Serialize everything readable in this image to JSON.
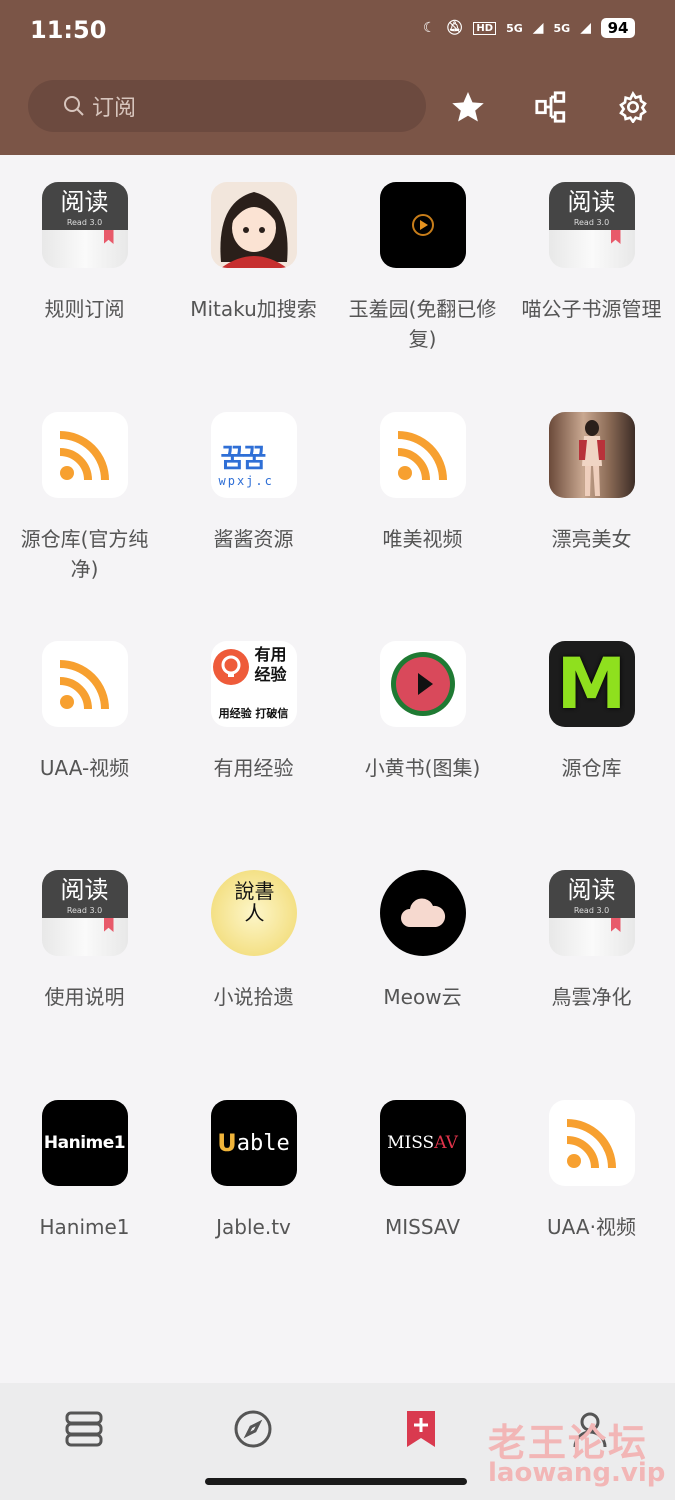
{
  "status_bar": {
    "time": "11:50",
    "signal_1": "5G",
    "signal_2": "5G",
    "battery": "94"
  },
  "header": {
    "search_placeholder": "订阅"
  },
  "grid": [
    {
      "label": "规则订阅",
      "icon": "read-app-icon"
    },
    {
      "label": "Mitaku加搜索",
      "icon": "anime-girl-avatar"
    },
    {
      "label": "玉羞园(免翻已修复)",
      "icon": "play-dot-icon"
    },
    {
      "label": "喵公子书源管理",
      "icon": "read-app-icon"
    },
    {
      "label": "源仓库(官方纯净)",
      "icon": "rss-icon"
    },
    {
      "label": "酱酱资源",
      "icon": "wpxj-logo"
    },
    {
      "label": "唯美视频",
      "icon": "rss-icon"
    },
    {
      "label": "漂亮美女",
      "icon": "photo-thumbnail"
    },
    {
      "label": "UAA-视频",
      "icon": "rss-icon"
    },
    {
      "label": "有用经验",
      "icon": "youyong-logo"
    },
    {
      "label": "小黄书(图集)",
      "icon": "watermelon-play-icon"
    },
    {
      "label": "源仓库",
      "icon": "m-letter-icon"
    },
    {
      "label": "使用说明",
      "icon": "read-app-icon"
    },
    {
      "label": "小说拾遗",
      "icon": "shuoshuren-logo"
    },
    {
      "label": "Meow云",
      "icon": "cloud-icon"
    },
    {
      "label": "鳥雲净化",
      "icon": "read-app-icon"
    },
    {
      "label": "Hanime1",
      "icon": "hanime-logo"
    },
    {
      "label": "Jable.tv",
      "icon": "jable-logo"
    },
    {
      "label": "MISSAV",
      "icon": "missav-logo"
    },
    {
      "label": "UAA·视频",
      "icon": "rss-icon"
    }
  ],
  "icon_text": {
    "read_title": "阅读",
    "read_sub": "Read 3.0",
    "wpxj": "wpxj.c",
    "youyong_1": "有用",
    "youyong_2": "经验",
    "youyong_3": "用经验 打破信",
    "hanime": "Hanime1",
    "jable": "able",
    "missav_1": "MISS",
    "missav_2": "AV",
    "m": "M",
    "shuo": "說書人"
  },
  "watermark": {
    "line1": "老王论坛",
    "line2": "laowang.vip"
  },
  "colors": {
    "header": "#7b5547",
    "accent": "#d93a4f",
    "rss": "#f7a030"
  }
}
